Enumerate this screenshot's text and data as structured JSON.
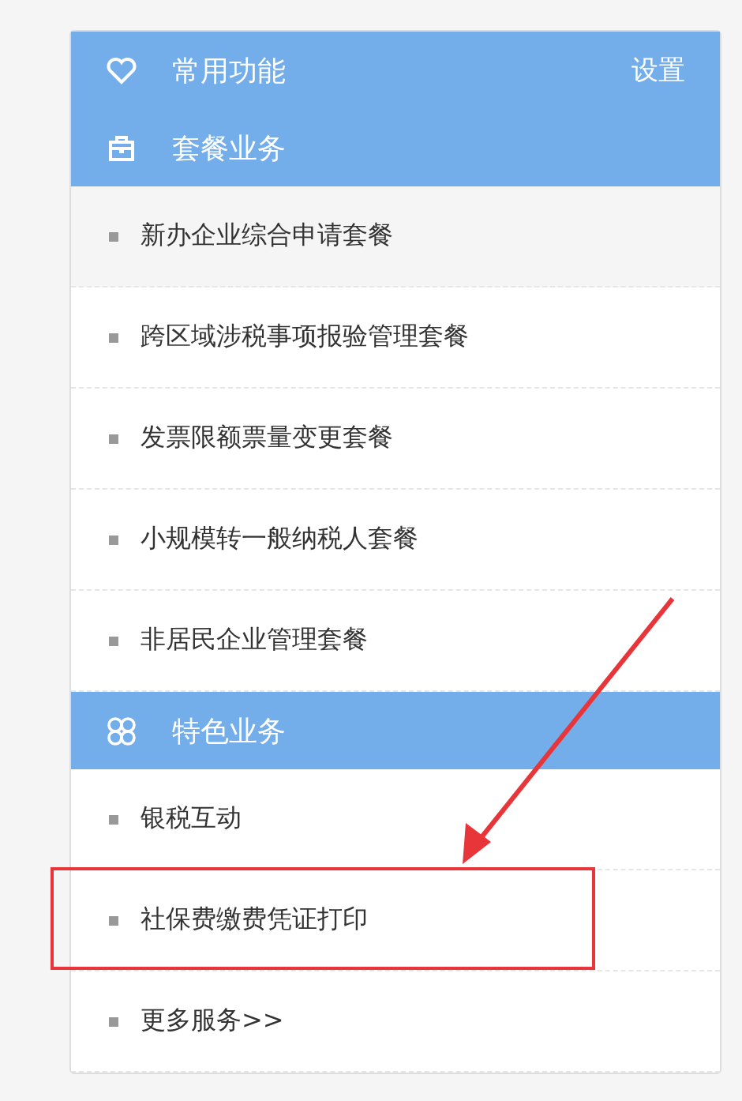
{
  "sections": [
    {
      "kind": "header",
      "title": "常用功能",
      "action": "设置"
    },
    {
      "kind": "header",
      "title": "套餐业务"
    },
    {
      "kind": "item",
      "label": "新办企业综合申请套餐",
      "selected": true,
      "highlighted": false
    },
    {
      "kind": "item",
      "label": "跨区域涉税事项报验管理套餐",
      "selected": false,
      "highlighted": false
    },
    {
      "kind": "item",
      "label": "发票限额票量变更套餐",
      "selected": false,
      "highlighted": false
    },
    {
      "kind": "item",
      "label": "小规模转一般纳税人套餐",
      "selected": false,
      "highlighted": false
    },
    {
      "kind": "item",
      "label": "非居民企业管理套餐",
      "selected": false,
      "highlighted": false
    },
    {
      "kind": "header",
      "title": "特色业务"
    },
    {
      "kind": "item",
      "label": "银税互动",
      "selected": false,
      "highlighted": false
    },
    {
      "kind": "item",
      "label": "社保费缴费凭证打印",
      "selected": false,
      "highlighted": true
    },
    {
      "kind": "item",
      "label": "更多服务>>",
      "selected": false,
      "highlighted": false
    }
  ]
}
